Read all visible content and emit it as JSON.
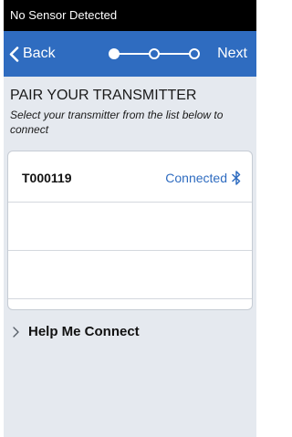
{
  "status_bar": {
    "text": "No Sensor Detected"
  },
  "nav": {
    "back_label": "Back",
    "next_label": "Next",
    "step_active": 1,
    "step_total": 3
  },
  "header": {
    "title": "PAIR YOUR TRANSMITTER",
    "subtitle": "Select your transmitter from the list below to connect"
  },
  "transmitters": [
    {
      "name": "T000119",
      "status": "Connected",
      "icon": "bluetooth-icon"
    },
    {
      "name": "",
      "status": ""
    },
    {
      "name": "",
      "status": ""
    }
  ],
  "help": {
    "label": "Help Me Connect",
    "icon": "chevron-right-icon"
  },
  "colors": {
    "nav_blue": "#2f6cc0",
    "background": "#e5e9ef",
    "status_bar": "#000000"
  }
}
